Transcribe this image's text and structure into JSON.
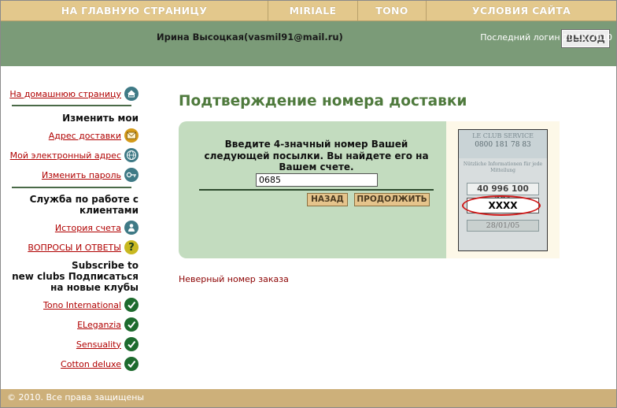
{
  "topnav": {
    "items": [
      {
        "label": "НА ГЛАВНУЮ СТРАНИЦУ"
      },
      {
        "label": "MIRIALE"
      },
      {
        "label": "TONO"
      },
      {
        "label": "УСЛОВИЯ САЙТА"
      }
    ]
  },
  "header": {
    "logout_label": "ВЫХОД",
    "user": "Ирина Высоцкая(vasmil91@mail.ru)",
    "last_login": "Последний логин 20.11.2010"
  },
  "sidebar": {
    "home_link": "На домашнюю страницу",
    "change_heading": "Изменить мои",
    "change_links": [
      "Адрес доставки",
      "Мой электронный адрес",
      "Изменить пароль"
    ],
    "service_heading": [
      "Служба по работе с",
      "клиентами"
    ],
    "service_links": [
      "История счета",
      "ВОПРОСЫ И ОТВЕТЫ"
    ],
    "subscribe_heading": [
      "Subscribe to",
      "new clubs Подписаться",
      "на новые клубы"
    ],
    "clubs": [
      "Tono International",
      "ELeganzia",
      "Sensuality",
      "Cotton deluxe"
    ]
  },
  "main": {
    "title": "Подтверждение номера доставки",
    "instruction": [
      "Введите 4-значный номер Вашей",
      "следующей посылки. Вы найдете его на",
      "Вашем счете."
    ],
    "order_value": "0685",
    "back_label": "НАЗАД",
    "continue_label": "ПРОДОЛЖИТЬ",
    "error": "Неверный номер заказа"
  },
  "card": {
    "line1": "LE CLUB SERVICE",
    "line2": "0800 181 78 83",
    "line3": "Nützliche Informationen für jede",
    "line4": "Mitteilung",
    "number": "40 996 100 201",
    "code": "XXXX",
    "date": "28/01/05"
  },
  "footer": {
    "copyright": "© 2010. Все права защищены"
  }
}
